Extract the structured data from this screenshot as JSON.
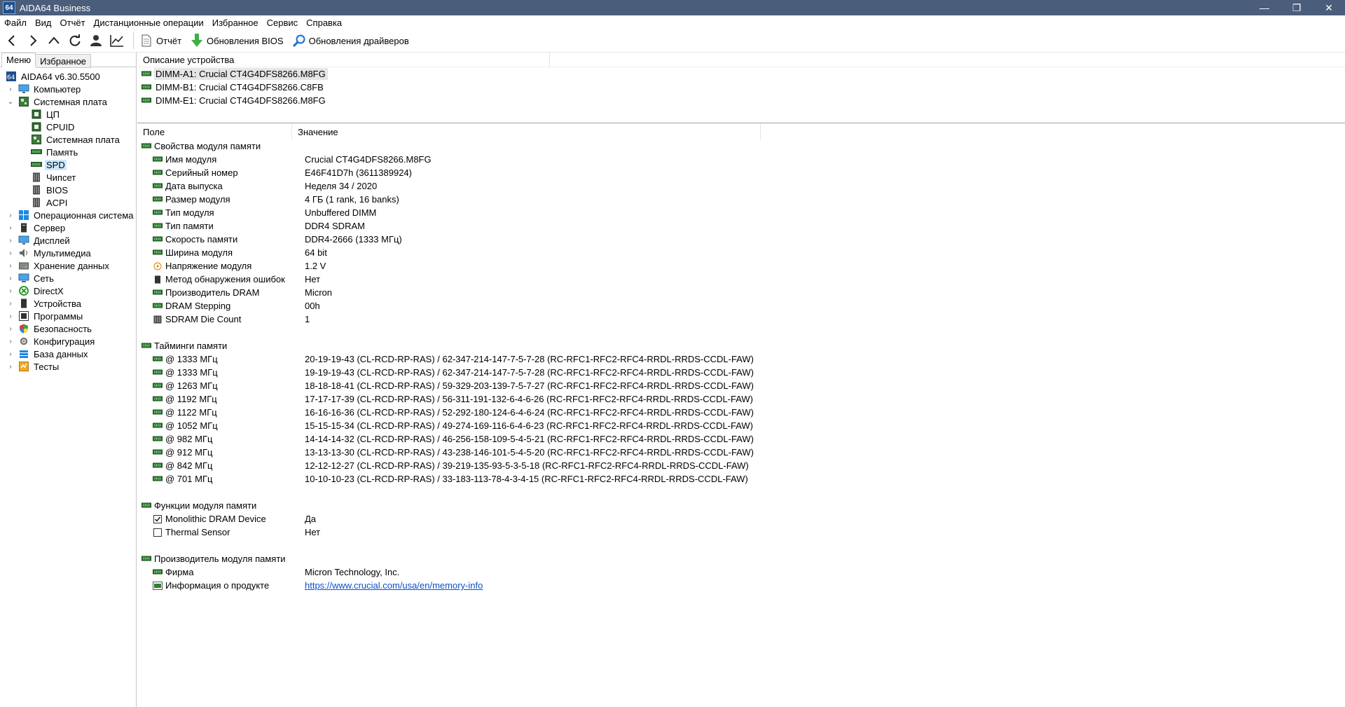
{
  "window": {
    "app_icon_text": "64",
    "title": "AIDA64 Business",
    "min": "—",
    "restore": "❐",
    "close": "✕"
  },
  "menubar": [
    "Файл",
    "Вид",
    "Отчёт",
    "Дистанционные операции",
    "Избранное",
    "Сервис",
    "Справка"
  ],
  "toolbar": {
    "report": "Отчёт",
    "bios_update": "Обновления BIOS",
    "driver_update": "Обновления драйверов"
  },
  "left_tabs": {
    "menu": "Меню",
    "favorites": "Избранное"
  },
  "tree": {
    "root": "AIDA64 v6.30.5500",
    "computer": "Компьютер",
    "motherboard": "Системная плата",
    "children": [
      "ЦП",
      "CPUID",
      "Системная плата",
      "Память",
      "SPD",
      "Чипсет",
      "BIOS",
      "ACPI"
    ],
    "selected": "SPD",
    "rest": [
      "Операционная система",
      "Сервер",
      "Дисплей",
      "Мультимедиа",
      "Хранение данных",
      "Сеть",
      "DirectX",
      "Устройства",
      "Программы",
      "Безопасность",
      "Конфигурация",
      "База данных",
      "Тесты"
    ]
  },
  "device_list": {
    "header": "Описание устройства",
    "items": [
      "DIMM-A1: Crucial CT4G4DFS8266.M8FG",
      "DIMM-B1: Crucial CT4G4DFS8266.C8FB",
      "DIMM-E1: Crucial CT4G4DFS8266.M8FG"
    ]
  },
  "details": {
    "col_field": "Поле",
    "col_value": "Значение",
    "module_props": {
      "title": "Свойства модуля памяти",
      "rows": [
        {
          "f": "Имя модуля",
          "v": "Crucial CT4G4DFS8266.M8FG"
        },
        {
          "f": "Серийный номер",
          "v": "E46F41D7h (3611389924)"
        },
        {
          "f": "Дата выпуска",
          "v": "Неделя 34 / 2020"
        },
        {
          "f": "Размер модуля",
          "v": "4 ГБ (1 rank, 16 banks)"
        },
        {
          "f": "Тип модуля",
          "v": "Unbuffered DIMM"
        },
        {
          "f": "Тип памяти",
          "v": "DDR4 SDRAM"
        },
        {
          "f": "Скорость памяти",
          "v": "DDR4-2666 (1333 МГц)"
        },
        {
          "f": "Ширина модуля",
          "v": "64 bit"
        },
        {
          "f": "Напряжение модуля",
          "v": "1.2 V"
        },
        {
          "f": "Метод обнаружения ошибок",
          "v": "Нет"
        },
        {
          "f": "Производитель DRAM",
          "v": "Micron"
        },
        {
          "f": "DRAM Stepping",
          "v": "00h"
        },
        {
          "f": "SDRAM Die Count",
          "v": "1"
        }
      ]
    },
    "timings": {
      "title": "Тайминги памяти",
      "rows": [
        {
          "f": "@ 1333 МГц",
          "v": "20-19-19-43  (CL-RCD-RP-RAS) / 62-347-214-147-7-5-7-28  (RC-RFC1-RFC2-RFC4-RRDL-RRDS-CCDL-FAW)"
        },
        {
          "f": "@ 1333 МГц",
          "v": "19-19-19-43  (CL-RCD-RP-RAS) / 62-347-214-147-7-5-7-28  (RC-RFC1-RFC2-RFC4-RRDL-RRDS-CCDL-FAW)"
        },
        {
          "f": "@ 1263 МГц",
          "v": "18-18-18-41  (CL-RCD-RP-RAS) / 59-329-203-139-7-5-7-27  (RC-RFC1-RFC2-RFC4-RRDL-RRDS-CCDL-FAW)"
        },
        {
          "f": "@ 1192 МГц",
          "v": "17-17-17-39  (CL-RCD-RP-RAS) / 56-311-191-132-6-4-6-26  (RC-RFC1-RFC2-RFC4-RRDL-RRDS-CCDL-FAW)"
        },
        {
          "f": "@ 1122 МГц",
          "v": "16-16-16-36  (CL-RCD-RP-RAS) / 52-292-180-124-6-4-6-24  (RC-RFC1-RFC2-RFC4-RRDL-RRDS-CCDL-FAW)"
        },
        {
          "f": "@ 1052 МГц",
          "v": "15-15-15-34  (CL-RCD-RP-RAS) / 49-274-169-116-6-4-6-23  (RC-RFC1-RFC2-RFC4-RRDL-RRDS-CCDL-FAW)"
        },
        {
          "f": "@ 982 МГц",
          "v": "14-14-14-32  (CL-RCD-RP-RAS) / 46-256-158-109-5-4-5-21  (RC-RFC1-RFC2-RFC4-RRDL-RRDS-CCDL-FAW)"
        },
        {
          "f": "@ 912 МГц",
          "v": "13-13-13-30  (CL-RCD-RP-RAS) / 43-238-146-101-5-4-5-20  (RC-RFC1-RFC2-RFC4-RRDL-RRDS-CCDL-FAW)"
        },
        {
          "f": "@ 842 МГц",
          "v": "12-12-12-27  (CL-RCD-RP-RAS) / 39-219-135-93-5-3-5-18  (RC-RFC1-RFC2-RFC4-RRDL-RRDS-CCDL-FAW)"
        },
        {
          "f": "@ 701 МГц",
          "v": "10-10-10-23  (CL-RCD-RP-RAS) / 33-183-113-78-4-3-4-15  (RC-RFC1-RFC2-RFC4-RRDL-RRDS-CCDL-FAW)"
        }
      ]
    },
    "features": {
      "title": "Функции модуля памяти",
      "rows": [
        {
          "f": "Monolithic DRAM Device",
          "v": "Да",
          "checked": true
        },
        {
          "f": "Thermal Sensor",
          "v": "Нет",
          "checked": false
        }
      ]
    },
    "manufacturer": {
      "title": "Производитель модуля памяти",
      "rows": [
        {
          "f": "Фирма",
          "v": "Micron Technology, Inc."
        },
        {
          "f": "Информация о продукте",
          "v": "https://www.crucial.com/usa/en/memory-info"
        }
      ]
    }
  },
  "colors": {
    "titlebar": "#4a5d7a",
    "selection": "#cce8ff",
    "link": "#0a50c8",
    "ram_green": "#2e7d32"
  }
}
